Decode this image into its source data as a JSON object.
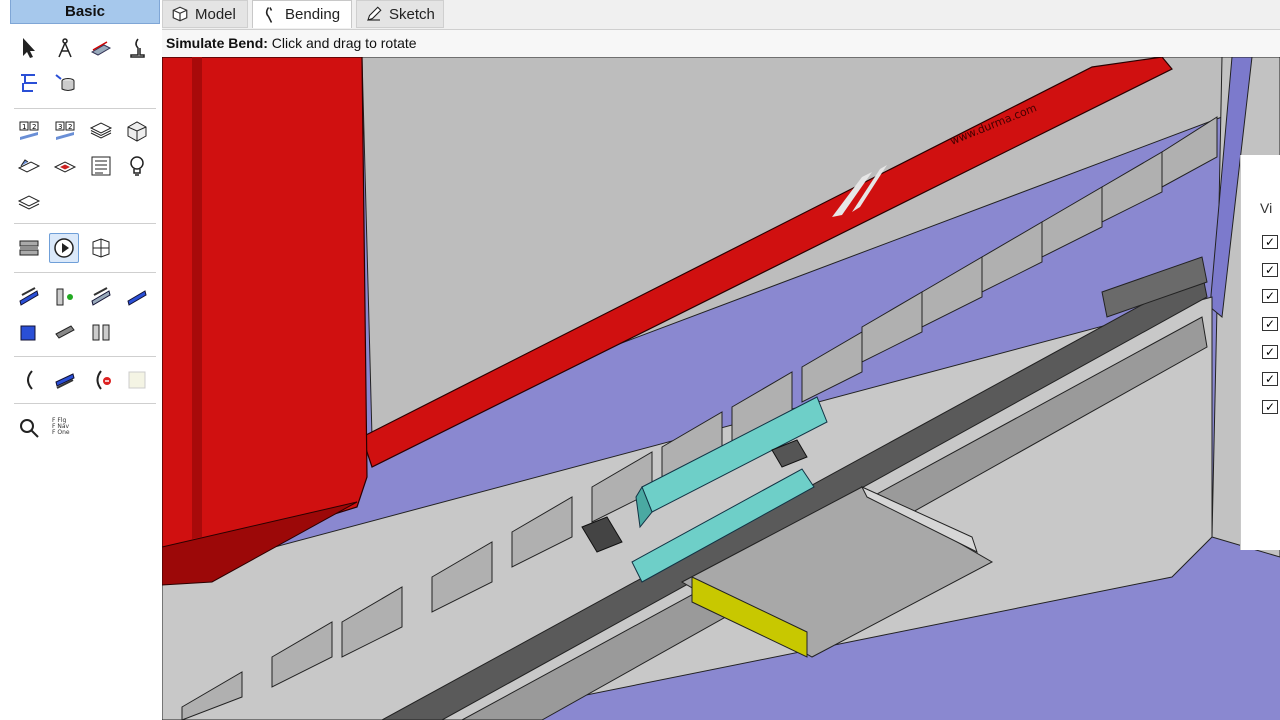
{
  "left_panel": {
    "header": "Basic",
    "flag_labels": [
      "F Flg",
      "F Nav",
      "F One"
    ]
  },
  "tabs": [
    {
      "label": "Model",
      "icon": "cube-icon"
    },
    {
      "label": "Bending",
      "icon": "bend-icon"
    },
    {
      "label": "Sketch",
      "icon": "pencil-icon"
    }
  ],
  "status": {
    "bold": "Simulate Bend:",
    "text": " Click and drag to rotate"
  },
  "side_panel": {
    "label": "Vi",
    "checkboxes": [
      true,
      true,
      true,
      true,
      true,
      true,
      true
    ]
  },
  "viewport": {
    "ram_logo_text": "www.durma.com",
    "colors": {
      "frame_red": "#d01010",
      "upper_tool_cyan": "#6ecfc8",
      "part_yellow": "#c8c800",
      "background_blue": "#8a88d0",
      "machine_gray": "#c8c8c8"
    }
  }
}
